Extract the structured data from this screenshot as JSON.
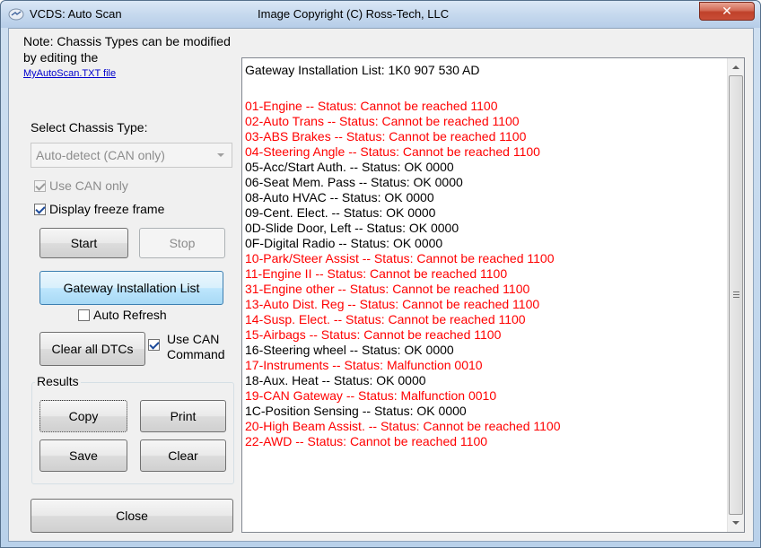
{
  "window": {
    "title": "VCDS:  Auto Scan",
    "copyright": "Image Copyright (C) Ross-Tech, LLC",
    "close_glyph": "✕"
  },
  "left": {
    "note": "Note:  Chassis Types can be modified by editing the",
    "note_link": "MyAutoScan.TXT file",
    "select_label": "Select Chassis Type:",
    "chassis_value": "Auto-detect (CAN only)",
    "use_can_only": {
      "label": "Use CAN only",
      "checked": true,
      "enabled": false
    },
    "display_freeze": {
      "label": "Display freeze frame",
      "checked": true
    },
    "start_label": "Start",
    "stop_label": "Stop",
    "gateway_label": "Gateway Installation List",
    "auto_refresh": {
      "label": "Auto Refresh",
      "checked": false
    },
    "clear_dtcs_label": "Clear all DTCs",
    "use_can_command": {
      "label_1": "Use CAN",
      "label_2": "Command",
      "checked": true
    },
    "results_label": "Results",
    "copy_label": "Copy",
    "print_label": "Print",
    "save_label": "Save",
    "clear_label": "Clear",
    "close_label": "Close"
  },
  "results": {
    "title": "Gateway Installation List:  1K0 907 530 AD",
    "lines": [
      {
        "text": "01-Engine -- Status: Cannot be reached 1100",
        "status": "err"
      },
      {
        "text": "02-Auto Trans -- Status: Cannot be reached 1100",
        "status": "err"
      },
      {
        "text": "03-ABS Brakes -- Status: Cannot be reached 1100",
        "status": "err"
      },
      {
        "text": "04-Steering Angle -- Status: Cannot be reached 1100",
        "status": "err"
      },
      {
        "text": "05-Acc/Start Auth. -- Status: OK 0000",
        "status": "ok"
      },
      {
        "text": "06-Seat Mem. Pass -- Status: OK 0000",
        "status": "ok"
      },
      {
        "text": "08-Auto HVAC -- Status: OK 0000",
        "status": "ok"
      },
      {
        "text": "09-Cent. Elect. -- Status: OK 0000",
        "status": "ok"
      },
      {
        "text": "0D-Slide Door, Left -- Status: OK 0000",
        "status": "ok"
      },
      {
        "text": "0F-Digital Radio -- Status: OK 0000",
        "status": "ok"
      },
      {
        "text": "10-Park/Steer Assist -- Status: Cannot be reached 1100",
        "status": "err"
      },
      {
        "text": "11-Engine II -- Status: Cannot be reached 1100",
        "status": "err"
      },
      {
        "text": "31-Engine other -- Status: Cannot be reached 1100",
        "status": "err"
      },
      {
        "text": "13-Auto Dist. Reg -- Status: Cannot be reached 1100",
        "status": "err"
      },
      {
        "text": "14-Susp. Elect. -- Status: Cannot be reached 1100",
        "status": "err"
      },
      {
        "text": "15-Airbags -- Status: Cannot be reached 1100",
        "status": "err"
      },
      {
        "text": "16-Steering wheel -- Status: OK 0000",
        "status": "ok"
      },
      {
        "text": "17-Instruments -- Status: Malfunction 0010",
        "status": "err"
      },
      {
        "text": "18-Aux. Heat -- Status: OK 0000",
        "status": "ok"
      },
      {
        "text": "19-CAN Gateway -- Status: Malfunction 0010",
        "status": "err"
      },
      {
        "text": "1C-Position Sensing -- Status: OK 0000",
        "status": "ok"
      },
      {
        "text": "20-High Beam Assist. -- Status: Cannot be reached 1100",
        "status": "err"
      },
      {
        "text": "22-AWD -- Status: Cannot be reached 1100",
        "status": "err"
      }
    ]
  },
  "colors": {
    "error_text": "#ff0000",
    "ok_text": "#000000",
    "link": "#0000cc"
  }
}
